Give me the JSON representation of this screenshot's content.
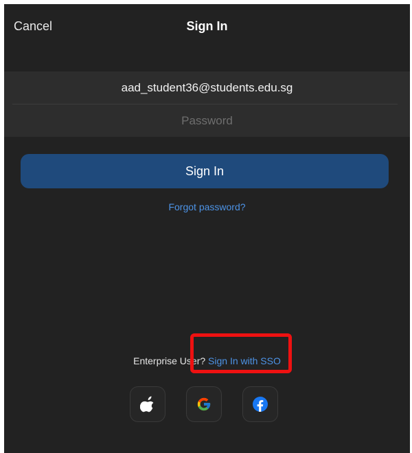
{
  "header": {
    "cancel_label": "Cancel",
    "title": "Sign In"
  },
  "form": {
    "email_value": "aad_student36@students.edu.sg",
    "password_placeholder": "Password"
  },
  "actions": {
    "signin_label": "Sign In",
    "forgot_label": "Forgot password?"
  },
  "enterprise": {
    "prompt": "Enterprise User?",
    "sso_label": "Sign In with SSO"
  },
  "social": {
    "icons": [
      "apple-icon",
      "google-icon",
      "facebook-icon"
    ]
  },
  "colors": {
    "background": "#222222",
    "button": "#1f4a7c",
    "link": "#4d93e6",
    "highlight": "#ee1111"
  }
}
